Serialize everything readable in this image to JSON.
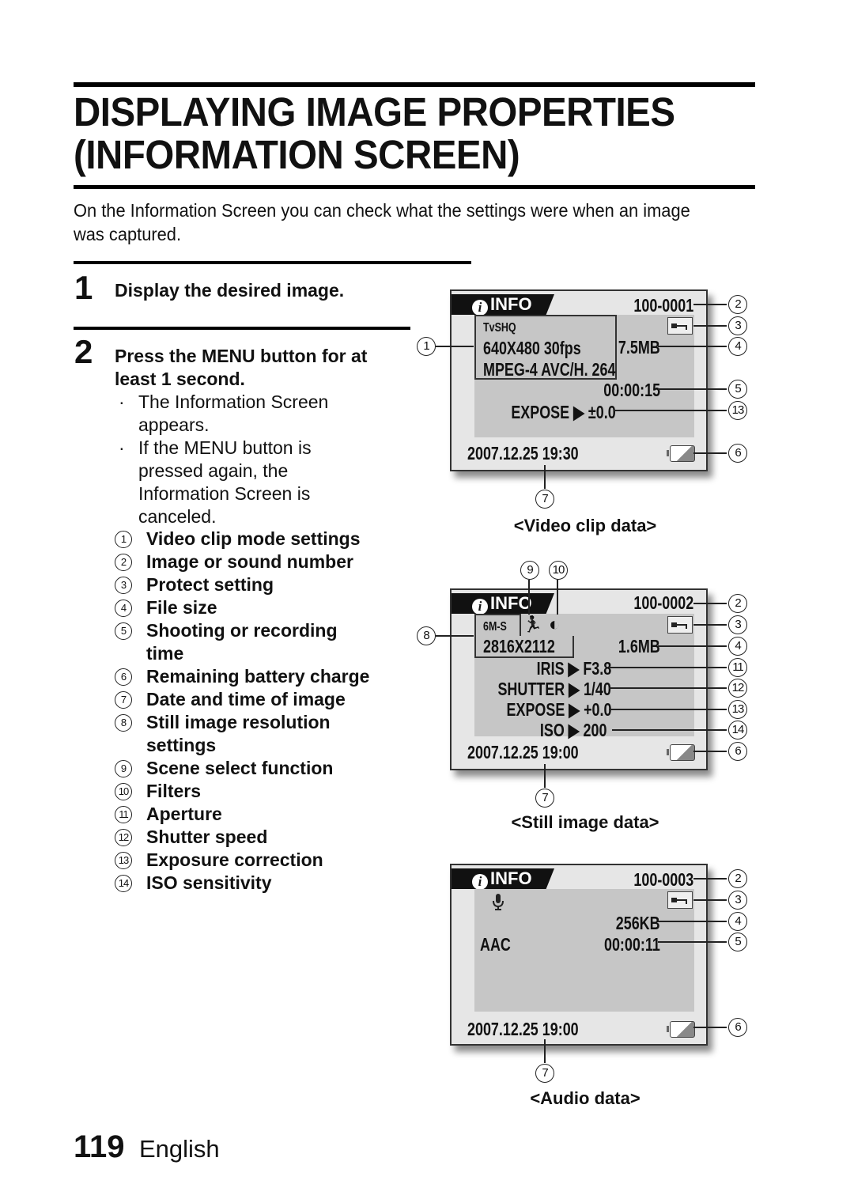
{
  "page": {
    "title_line1": "DISPLAYING IMAGE PROPERTIES",
    "title_line2": "(INFORMATION SCREEN)",
    "intro": "On the Information Screen you can check what the settings were when an image was captured.",
    "page_number": "119",
    "language": "English"
  },
  "steps": [
    {
      "number": "1",
      "text": "Display the desired image."
    },
    {
      "number": "2",
      "text_line1": "Press the MENU button for at",
      "text_line2": "least 1 second.",
      "bullets": [
        {
          "line1": "The Information Screen",
          "line2": "appears."
        },
        {
          "line1": "If the MENU button is",
          "line2": "pressed again, the",
          "line3": "Information Screen is",
          "line4": "canceled."
        }
      ]
    }
  ],
  "legend": [
    {
      "num": "1",
      "line1": "Video clip mode settings"
    },
    {
      "num": "2",
      "line1": "Image or sound number"
    },
    {
      "num": "3",
      "line1": "Protect setting"
    },
    {
      "num": "4",
      "line1": "File size"
    },
    {
      "num": "5",
      "line1": "Shooting or recording",
      "line2": "time"
    },
    {
      "num": "6",
      "line1": "Remaining battery charge"
    },
    {
      "num": "7",
      "line1": "Date and time of image"
    },
    {
      "num": "8",
      "line1": "Still image resolution",
      "line2": "settings"
    },
    {
      "num": "9",
      "line1": "Scene select function"
    },
    {
      "num": "10",
      "line1": "Filters"
    },
    {
      "num": "11",
      "line1": "Aperture"
    },
    {
      "num": "12",
      "line1": "Shutter speed"
    },
    {
      "num": "13",
      "line1": "Exposure correction"
    },
    {
      "num": "14",
      "line1": "ISO sensitivity"
    }
  ],
  "screens": {
    "video": {
      "caption": "<Video clip data>",
      "tab_label": "INFO",
      "file_number": "100-0001",
      "mode_icon": "TvSHQ",
      "resolution": "640X480 30fps",
      "codec": "MPEG-4 AVC/H. 264",
      "file_size": "7.5MB",
      "duration": "00:00:15",
      "expose_label": "EXPOSE",
      "expose_value": "±0.0",
      "datetime": "2007.12.25 19:30",
      "callouts": [
        "1",
        "2",
        "3",
        "4",
        "5",
        "13",
        "6",
        "7"
      ]
    },
    "still": {
      "caption": "<Still image data>",
      "tab_label": "INFO",
      "file_number": "100-0002",
      "mode_icon": "6M-S",
      "resolution": "2816X2112",
      "file_size": "1.6MB",
      "iris_label": "IRIS",
      "iris_value": "F3.8",
      "shutter_label": "SHUTTER",
      "shutter_value": "1/40",
      "expose_label": "EXPOSE",
      "expose_value": "+0.0",
      "iso_label": "ISO",
      "iso_value": "200",
      "datetime": "2007.12.25 19:00",
      "callouts": [
        "9",
        "10",
        "8",
        "2",
        "3",
        "4",
        "11",
        "12",
        "13",
        "14",
        "6",
        "7"
      ]
    },
    "audio": {
      "caption": "<Audio data>",
      "tab_label": "INFO",
      "file_number": "100-0003",
      "file_size": "256KB",
      "codec": "AAC",
      "duration": "00:00:11",
      "datetime": "2007.12.25 19:00",
      "callouts": [
        "2",
        "3",
        "4",
        "5",
        "6",
        "7"
      ]
    }
  },
  "icons": {
    "info": "i",
    "arrow": "▶",
    "runner": "🏃",
    "filter": "◐",
    "mic": "🎙"
  }
}
